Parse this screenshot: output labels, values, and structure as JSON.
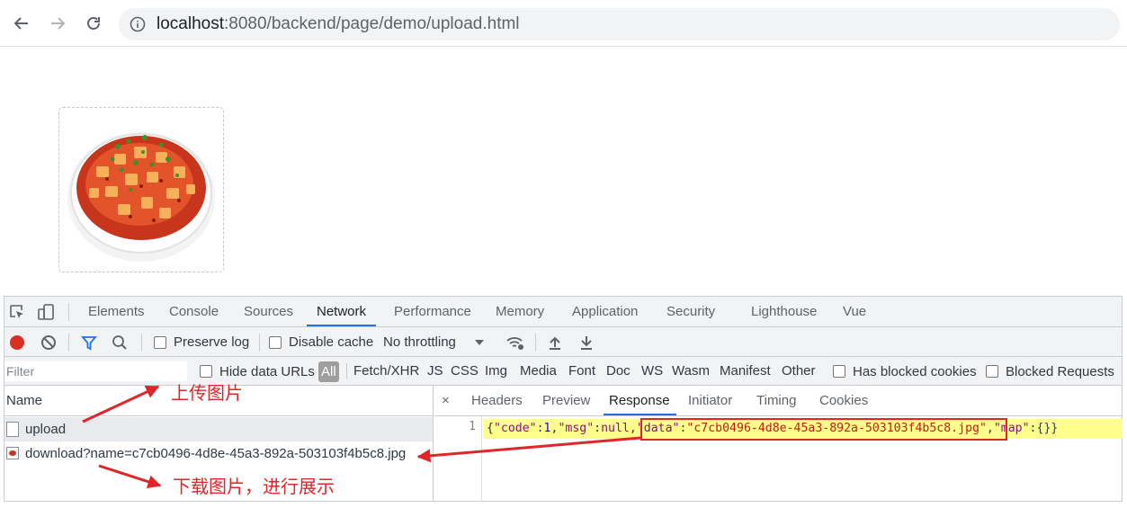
{
  "browser": {
    "url_host": "localhost",
    "url_rest": ":8080/backend/page/demo/upload.html"
  },
  "devtools": {
    "tabs": [
      "Elements",
      "Console",
      "Sources",
      "Network",
      "Performance",
      "Memory",
      "Application",
      "Security",
      "Lighthouse",
      "Vue"
    ],
    "active_tab": "Network",
    "toolbar": {
      "preserve_log": "Preserve log",
      "disable_cache": "Disable cache",
      "throttling": "No throttling"
    },
    "filter": {
      "placeholder": "Filter",
      "hide_data_urls": "Hide data URLs",
      "types": [
        "All",
        "Fetch/XHR",
        "JS",
        "CSS",
        "Img",
        "Media",
        "Font",
        "Doc",
        "WS",
        "Wasm",
        "Manifest",
        "Other"
      ],
      "has_blocked_cookies": "Has blocked cookies",
      "blocked_requests": "Blocked Requests"
    },
    "requests": {
      "header": "Name",
      "items": [
        {
          "name": "upload"
        },
        {
          "name": "download?name=c7cb0496-4d8e-45a3-892a-503103f4b5c8.jpg"
        }
      ]
    },
    "detail": {
      "close": "×",
      "tabs": [
        "Headers",
        "Preview",
        "Response",
        "Initiator",
        "Timing",
        "Cookies"
      ],
      "active_tab": "Response",
      "line_number": "1",
      "response_text": "{\"code\":1,\"msg\":null,\"data\":\"c7cb0496-4d8e-45a3-892a-503103f4b5c8.jpg\",\"map\":{}}"
    }
  },
  "annotations": {
    "upload": "上传图片",
    "download": "下载图片，进行展示"
  },
  "colors": {
    "annotation_red": "#e0262a",
    "accent_blue": "#1a73e8",
    "record_red": "#d93025"
  }
}
